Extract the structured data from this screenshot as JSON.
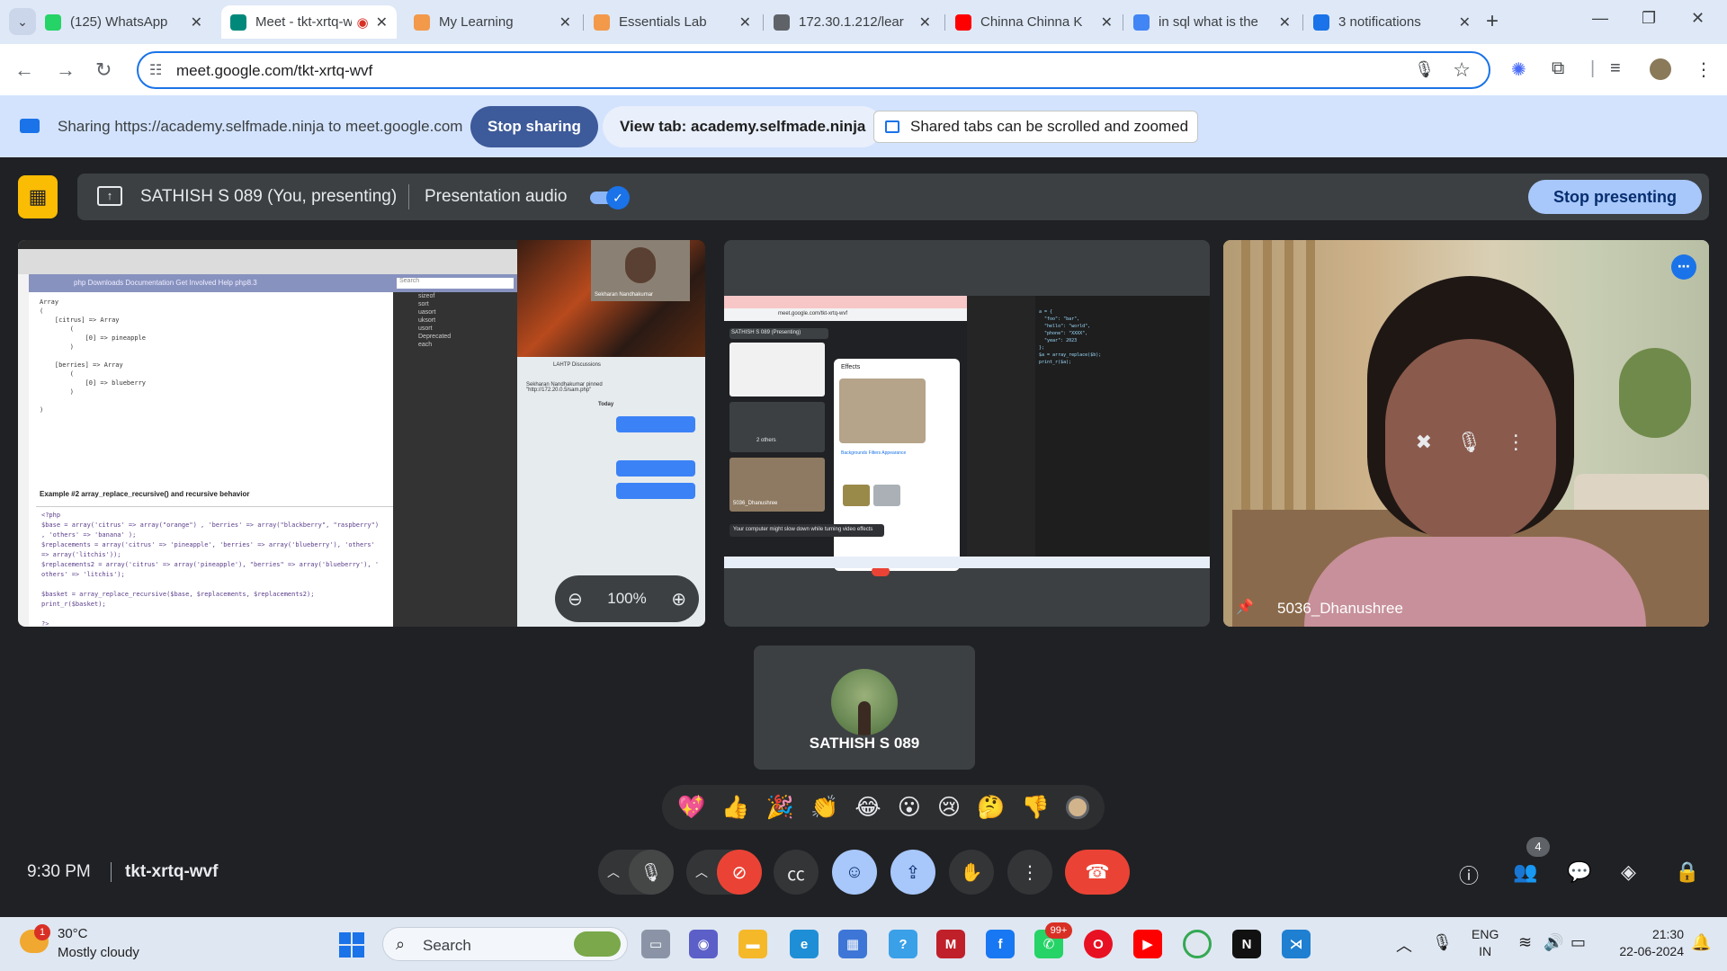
{
  "browser": {
    "tabs": [
      {
        "title": "(125) WhatsApp",
        "favicon": "whatsapp-icon",
        "color": "#25d366",
        "active": false
      },
      {
        "title": "Meet - tkt-xrtq-wvf",
        "favicon": "meet-icon",
        "color": "#00897b",
        "active": true,
        "recording": true
      },
      {
        "title": "My Learning",
        "favicon": "learning-icon",
        "color": "#f2994a",
        "active": false
      },
      {
        "title": "Essentials Lab",
        "favicon": "lab-icon",
        "color": "#f2994a",
        "active": false
      },
      {
        "title": "172.30.1.212/lear",
        "favicon": "globe-icon",
        "color": "#5f6368",
        "active": false
      },
      {
        "title": "Chinna Chinna K",
        "favicon": "youtube-icon",
        "color": "#ff0000",
        "active": false
      },
      {
        "title": "in sql what is the",
        "favicon": "google-icon",
        "color": "#4285f4",
        "active": false
      },
      {
        "title": "3 notifications",
        "favicon": "notification-icon",
        "color": "#1a73e8",
        "active": false
      }
    ],
    "url": "meet.google.com/tkt-xrtq-wvf"
  },
  "share_bar": {
    "text": "Sharing https://academy.selfmade.ninja to meet.google.com",
    "stop_sharing": "Stop sharing",
    "view_tab": "View tab: academy.selfmade.ninja",
    "scroll_note": "Shared tabs can be scrolled and zoomed"
  },
  "presenting_bar": {
    "presenter": "SATHISH S 089 (You, presenting)",
    "audio_label": "Presentation audio",
    "audio_on": true,
    "stop_presenting": "Stop presenting"
  },
  "shared_screen": {
    "zoom": "100%",
    "php_nav": "php   Downloads   Documentation   Get Involved   Help   php8.3",
    "search_placeholder": "Search",
    "example_title": "Example #2 array_replace_recursive() and recursive behavior",
    "output_code": "Array\n(\n    [citrus] => Array\n        (\n            [0] => pineapple\n        )\n\n    [berries] => Array\n        (\n            [0] => blueberry\n        )\n\n)",
    "php_code": "<?php\n$base = array('citrus' => array(\"orange\") , 'berries' => array(\"blackberry\", \"raspberry\")\n, 'others' => 'banana' );\n$replacements = array('citrus' => 'pineapple', 'berries' => array('blueberry'), 'others'\n=> array('litchis'));\n$replacements2 = array('citrus' => array('pineapple'), \"berries\" => array('blueberry'), '\nothers' => 'litchis');\n\n$basket = array_replace_recursive($base, $replacements, $replacements2);\nprint_r($basket);\n\n?>",
    "sidebar_items": [
      "sizeof",
      "sort",
      "uasort",
      "uksort",
      "usort",
      "Deprecated",
      "each"
    ],
    "telegram_video_name": "Sekharan Nandhakumar",
    "telegram_messages": [
      "LAHTP Discussions",
      "Today",
      "Sekharan Nandhakumar pinned \"http://172.20.0.5/sam.php\""
    ]
  },
  "mini_meet": {
    "url": "meet.google.com/tkt-xrtq-wvf",
    "presenter": "SATHISH S 089 (Presenting)",
    "effects_title": "Effects",
    "effects_tabs": "Backgrounds   Filters   Appearance",
    "others": "2 others",
    "toast": "Your computer might slow down while turning video effects",
    "tile_name": "5036_Dhanushree",
    "code": "a = {\n  \"foo\": \"bar\",\n  \"hello\": \"world\",\n  \"phone\": \"XXXX\",\n  \"year\": 2023\n};\n$a = array_replace($b);\nprint_r($a);"
  },
  "participants": [
    {
      "name": "5036_Dhanushree",
      "pinned": true
    },
    {
      "name": "SATHISH S 089",
      "avatar": "avatar"
    }
  ],
  "reactions": [
    "💖",
    "👍",
    "🎉",
    "👏",
    "😂",
    "😮",
    "😢",
    "🤔",
    "👎"
  ],
  "meeting": {
    "time": "9:30 PM",
    "code": "tkt-xrtq-wvf",
    "people_count": "4"
  },
  "taskbar": {
    "temp": "30°C",
    "condition": "Mostly cloudy",
    "weather_badge": "1",
    "search": "Search",
    "whatsapp_badge": "99+",
    "lang_line1": "ENG",
    "lang_line2": "IN",
    "time": "21:30",
    "date": "22-06-2024"
  }
}
